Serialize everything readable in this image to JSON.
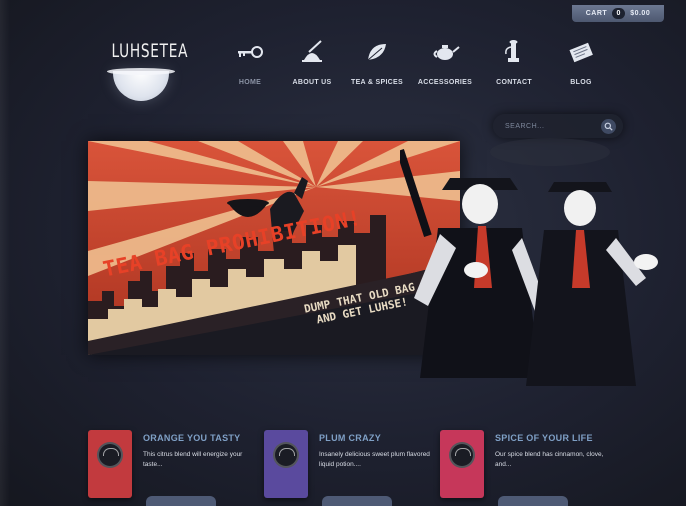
{
  "brand": {
    "logo_text": "LUHSETEA"
  },
  "cart": {
    "label": "CART",
    "count": "0",
    "total": "$0.00"
  },
  "nav": [
    {
      "label": "HOME",
      "icon": "key-icon",
      "active": true
    },
    {
      "label": "ABOUT US",
      "icon": "cloche-icon"
    },
    {
      "label": "TEA & SPICES",
      "icon": "leaf-icon"
    },
    {
      "label": "ACCESSORIES",
      "icon": "teapot-icon"
    },
    {
      "label": "CONTACT",
      "icon": "telephone-icon"
    },
    {
      "label": "BLOG",
      "icon": "newspaper-icon"
    }
  ],
  "search": {
    "placeholder": "SEARCH..."
  },
  "banner": {
    "headline": "TEA BAG PROHIBITION!",
    "tagline_line1": "DUMP THAT OLD BAG",
    "tagline_line2": "AND GET LUHSE!"
  },
  "products": [
    {
      "title": "ORANGE YOU TASTY",
      "description": "This citrus blend will energize your taste...",
      "color": "#c23a3e"
    },
    {
      "title": "PLUM CRAZY",
      "description": "Insanely delicious sweet plum flavored liquid potion....",
      "color": "#5a4a9e"
    },
    {
      "title": "SPICE OF YOUR LIFE",
      "description": "Our spice blend has cinnamon, clove, and...",
      "color": "#c6375a"
    }
  ],
  "colors": {
    "background": "#1e2130",
    "accent": "#e74127",
    "nav_text": "#d7dce6",
    "product_title": "#7fa0c6"
  }
}
